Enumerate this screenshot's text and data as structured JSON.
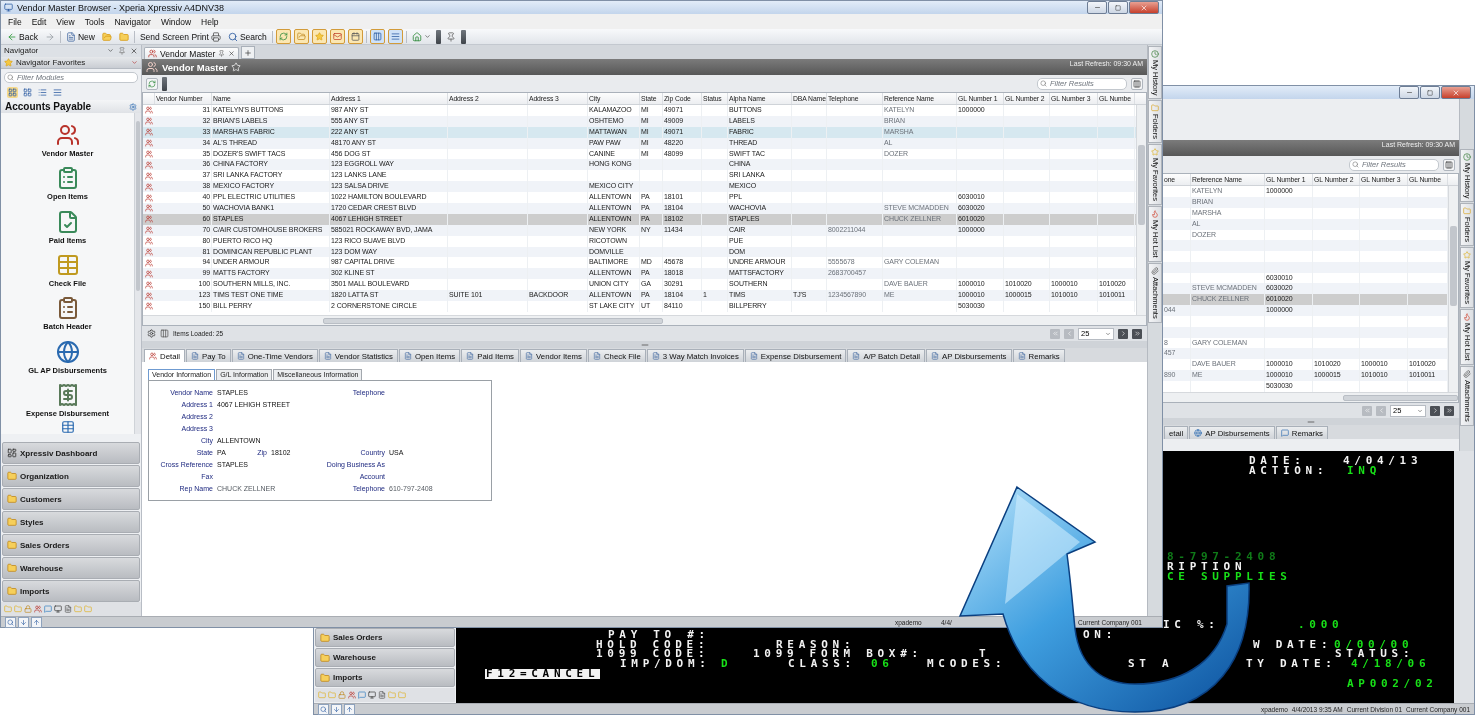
{
  "main_window": {
    "title": "Vendor Master Browser - Xperia Xpressiv A4DNV38",
    "menu": [
      "File",
      "Edit",
      "View",
      "Tools",
      "Navigator",
      "Window",
      "Help"
    ],
    "toolbar": [
      {
        "kind": "back",
        "label": "Back"
      },
      {
        "kind": "new",
        "label": "New"
      },
      {
        "kind": "print",
        "label": "Send Screen Print"
      },
      {
        "kind": "search",
        "label": "Search"
      }
    ],
    "navigator": {
      "title": "Navigator",
      "favorites": "Navigator Favorites",
      "filter_placeholder": "Filter Modules",
      "section": "Accounts Payable",
      "modules": [
        {
          "kind": "vendor",
          "label": "Vendor Master"
        },
        {
          "kind": "open",
          "label": "Open Items"
        },
        {
          "kind": "paid",
          "label": "Paid Items"
        },
        {
          "kind": "check",
          "label": "Check File"
        },
        {
          "kind": "batch",
          "label": "Batch Header"
        },
        {
          "kind": "disbursement",
          "label": "GL AP Disbursements"
        },
        {
          "kind": "expense",
          "label": "Expense Disbursement"
        }
      ],
      "groups": [
        {
          "kind": "dashboard",
          "label": "Xpressiv Dashboard"
        },
        {
          "kind": "folder",
          "label": "Organization"
        },
        {
          "kind": "folder",
          "label": "Customers"
        },
        {
          "kind": "folder",
          "label": "Styles"
        },
        {
          "kind": "folder",
          "label": "Sales Orders"
        },
        {
          "kind": "folder",
          "label": "Warehouse"
        },
        {
          "kind": "folder",
          "label": "Imports"
        }
      ]
    },
    "document_tab": "Vendor Master",
    "header": {
      "title": "Vendor Master",
      "last_refresh": "Last Refresh: 09:30 AM"
    },
    "filter_placeholder": "Filter Results",
    "table": {
      "columns": [
        "Vendor Number",
        "Name",
        "Address 1",
        "Address 2",
        "Address 3",
        "City",
        "State",
        "Zip Code",
        "Status",
        "Alpha Name",
        "DBA Name",
        "Telephone",
        "Reference Name",
        "GL Number 1",
        "GL Number 2",
        "GL Number 3",
        "GL Numbe"
      ],
      "rows": [
        {
          "selected": false,
          "highlighted": false,
          "cells": [
            "31",
            "KATELYN'S BUTTONS",
            "987 ANY ST",
            null,
            null,
            "KALAMAZOO",
            "MI",
            "49071",
            null,
            "BUTTONS",
            null,
            null,
            "KATELYN",
            "1000000",
            null,
            null,
            null
          ]
        },
        {
          "selected": false,
          "highlighted": false,
          "cells": [
            "32",
            "BRIAN'S LABELS",
            "555 ANY ST",
            null,
            null,
            "OSHTEMO",
            "MI",
            "49009",
            null,
            "LABELS",
            null,
            null,
            "BRIAN",
            null,
            null,
            null,
            null
          ]
        },
        {
          "selected": false,
          "highlighted": true,
          "cells": [
            "33",
            "MARSHA'S FABRIC",
            "222 ANY ST",
            null,
            null,
            "MATTAWAN",
            "MI",
            "49071",
            null,
            "FABRIC",
            null,
            null,
            "MARSHA",
            null,
            null,
            null,
            null
          ]
        },
        {
          "selected": false,
          "highlighted": false,
          "cells": [
            "34",
            "AL'S THREAD",
            "48170 ANY ST",
            null,
            null,
            "PAW PAW",
            "MI",
            "48220",
            null,
            "THREAD",
            null,
            null,
            "AL",
            null,
            null,
            null,
            null
          ]
        },
        {
          "selected": false,
          "highlighted": false,
          "cells": [
            "35",
            "DOZER'S SWIFT TACS",
            "456 DOG ST",
            null,
            null,
            "CANINE",
            "MI",
            "48099",
            null,
            "SWIFT TAC",
            null,
            null,
            "DOZER",
            null,
            null,
            null,
            null
          ]
        },
        {
          "selected": false,
          "highlighted": false,
          "cells": [
            "36",
            "CHINA FACTORY",
            "123 EGGROLL WAY",
            null,
            null,
            "HONG KONG",
            null,
            null,
            null,
            "CHINA",
            null,
            null,
            null,
            null,
            null,
            null,
            null
          ]
        },
        {
          "selected": false,
          "highlighted": false,
          "cells": [
            "37",
            "SRI LANKA FACTORY",
            "123 LANKS LANE",
            null,
            null,
            null,
            null,
            null,
            null,
            "SRI LANKA",
            null,
            null,
            null,
            null,
            null,
            null,
            null
          ]
        },
        {
          "selected": false,
          "highlighted": false,
          "cells": [
            "38",
            "MEXICO FACTORY",
            "123 SALSA DRIVE",
            null,
            null,
            "MEXICO CITY",
            null,
            null,
            null,
            "MEXICO",
            null,
            null,
            null,
            null,
            null,
            null,
            null
          ]
        },
        {
          "selected": false,
          "highlighted": false,
          "cells": [
            "40",
            "PPL ELECTRIC UTILITIES",
            "1022 HAMILTON BOULEVARD",
            null,
            null,
            "ALLENTOWN",
            "PA",
            "18101",
            null,
            "PPL",
            null,
            null,
            null,
            "6030010",
            null,
            null,
            null
          ]
        },
        {
          "selected": false,
          "highlighted": false,
          "cells": [
            "50",
            "WACHOVIA BANK1",
            "1720 CEDAR CREST BLVD",
            null,
            null,
            "ALLENTOWN",
            "PA",
            "18104",
            null,
            "WACHOVIA",
            null,
            null,
            "STEVE MCMADDEN",
            "6030020",
            null,
            null,
            null
          ]
        },
        {
          "selected": true,
          "highlighted": false,
          "cells": [
            "60",
            "STAPLES",
            "4067 LEHIGH STREET",
            null,
            null,
            "ALLENTOWN",
            "PA",
            "18102",
            null,
            "STAPLES",
            null,
            null,
            "CHUCK ZELLNER",
            "6010020",
            null,
            null,
            null
          ]
        },
        {
          "selected": false,
          "highlighted": false,
          "cells": [
            "70",
            "C/AIR CUSTOMHOUSE BROKERS",
            "585021 ROCKAWAY BVD, JAMA",
            null,
            null,
            "NEW YORK",
            "NY",
            "11434",
            null,
            "CAIR",
            null,
            "8002211044",
            null,
            "1000000",
            null,
            null,
            null
          ]
        },
        {
          "selected": false,
          "highlighted": false,
          "cells": [
            "80",
            "PUERTO RICO HQ",
            "123 RICO SUAVE BLVD",
            null,
            null,
            "RICOTOWN",
            null,
            null,
            null,
            "PUE",
            null,
            null,
            null,
            null,
            null,
            null,
            null
          ]
        },
        {
          "selected": false,
          "highlighted": false,
          "cells": [
            "81",
            "DOMINICAN REPUBLIC PLANT",
            "123 DOM WAY",
            null,
            null,
            "DOMVILLE",
            null,
            null,
            null,
            "DOM",
            null,
            null,
            null,
            null,
            null,
            null,
            null
          ]
        },
        {
          "selected": false,
          "highlighted": false,
          "cells": [
            "94",
            "UNDER ARMOUR",
            "987 CAPITAL DRIVE",
            null,
            null,
            "BALTIMORE",
            "MD",
            "45678",
            null,
            "UNDRE ARMOUR",
            null,
            "5555678",
            "GARY COLEMAN",
            null,
            null,
            null,
            null
          ]
        },
        {
          "selected": false,
          "highlighted": false,
          "cells": [
            "99",
            "MATTS FACTORY",
            "302 KLINE ST",
            null,
            null,
            "ALLENTOWN",
            "PA",
            "18018",
            null,
            "MATTSFACTORY",
            null,
            "2683700457",
            null,
            null,
            null,
            null,
            null
          ]
        },
        {
          "selected": false,
          "highlighted": false,
          "cells": [
            "100",
            "SOUTHERN MILLS, INC.",
            "3501 MALL BOULEVARD",
            null,
            null,
            "UNION CITY",
            "GA",
            "30291",
            null,
            "SOUTHERN",
            null,
            null,
            "DAVE BAUER",
            "1000010",
            "1010020",
            "1000010",
            "1010020"
          ]
        },
        {
          "selected": false,
          "highlighted": false,
          "cells": [
            "123",
            "TIMS TEST ONE TIME",
            "1820 LATTA ST",
            "SUITE 101",
            "BACKDOOR",
            "ALLENTOWN",
            "PA",
            "18104",
            "1",
            "TIMS",
            "TJ'S",
            "1234567890",
            "ME",
            "1000010",
            "1000015",
            "1010010",
            "1010011"
          ]
        },
        {
          "selected": false,
          "highlighted": false,
          "cells": [
            "150",
            "BILL PERRY",
            "2 CORNERSTONE CIRCLE",
            null,
            null,
            "ST LAKE CITY",
            "UT",
            "84110",
            null,
            "BILLPERRY",
            null,
            null,
            null,
            "5030030",
            null,
            null,
            null
          ]
        }
      ]
    },
    "items_loaded": "Items Loaded:  25",
    "page_size": "25",
    "detail_tabs": [
      {
        "label": "Detail",
        "selected": true
      },
      {
        "label": "Pay To",
        "selected": false
      },
      {
        "label": "One-Time Vendors",
        "selected": false
      },
      {
        "label": "Vendor Statistics",
        "selected": false
      },
      {
        "label": "Open Items",
        "selected": false
      },
      {
        "label": "Paid Items",
        "selected": false
      },
      {
        "label": "Vendor Items",
        "selected": false
      },
      {
        "label": "Check File",
        "selected": false
      },
      {
        "label": "3 Way Match Invoices",
        "selected": false
      },
      {
        "label": "Expense Disbursement",
        "selected": false
      },
      {
        "label": "A/P Batch Detail",
        "selected": false
      },
      {
        "label": "AP Disbursements",
        "selected": false
      },
      {
        "label": "Remarks",
        "selected": false
      }
    ],
    "form_tabs": [
      {
        "label": "Vendor Information",
        "selected": true
      },
      {
        "label": "G/L Information",
        "selected": false
      },
      {
        "label": "Miscellaneous Information",
        "selected": false
      }
    ],
    "form": [
      {
        "left": {
          "label": "Vendor Name",
          "value": "STAPLES"
        },
        "right": {
          "label": "Telephone"
        }
      },
      {
        "left": {
          "label": "Address 1",
          "value": "4067 LEHIGH STREET"
        }
      },
      {
        "left": {
          "label": "Address 2"
        }
      },
      {
        "left": {
          "label": "Address 3"
        }
      },
      {
        "left": {
          "label": "City",
          "value": "ALLENTOWN"
        }
      },
      {
        "left": {
          "label": "State",
          "value": "PA"
        },
        "middle": {
          "label": "Zip",
          "value": "18102"
        },
        "right": {
          "label": "Country",
          "value": "USA"
        }
      },
      {
        "left": {
          "label": "Cross Reference",
          "value": "STAPLES"
        },
        "right": {
          "label": "Doing Business As"
        }
      },
      {
        "left": {
          "label": "Fax"
        },
        "right": {
          "label": "Account"
        }
      },
      {
        "left": {
          "label": "Rep Name",
          "value": "CHUCK ZELLNER"
        },
        "right": {
          "label": "Telephone",
          "value": "610-797-2408"
        }
      }
    ],
    "side_tabs": [
      "My History",
      "Folders",
      "My Favorites",
      "My Hot List",
      "Attachments"
    ],
    "status_bar": [
      "xpademo",
      "4/4/",
      "Current Company 001"
    ]
  },
  "back_window": {
    "header": {
      "last_refresh": "Last Refresh: 09:30 AM"
    },
    "filter_placeholder": "Filter Results",
    "table": {
      "columns": [
        "one",
        "Reference Name",
        "GL Number 1",
        "GL Number 2",
        "GL Number 3",
        "GL Numbe"
      ],
      "rows": [
        {
          "selected": false,
          "cells": [
            null,
            "KATELYN",
            "1000000",
            null,
            null,
            null
          ]
        },
        {
          "selected": false,
          "cells": [
            null,
            "BRIAN",
            null,
            null,
            null,
            null
          ]
        },
        {
          "selected": false,
          "cells": [
            null,
            "MARSHA",
            null,
            null,
            null,
            null
          ]
        },
        {
          "selected": false,
          "cells": [
            null,
            "AL",
            null,
            null,
            null,
            null
          ]
        },
        {
          "selected": false,
          "cells": [
            null,
            "DOZER",
            null,
            null,
            null,
            null
          ]
        },
        {
          "selected": false,
          "cells": [
            null,
            null,
            null,
            null,
            null,
            null
          ]
        },
        {
          "selected": false,
          "cells": [
            null,
            null,
            null,
            null,
            null,
            null
          ]
        },
        {
          "selected": false,
          "cells": [
            null,
            null,
            null,
            null,
            null,
            null
          ]
        },
        {
          "selected": false,
          "cells": [
            null,
            null,
            "6030010",
            null,
            null,
            null
          ]
        },
        {
          "selected": false,
          "cells": [
            null,
            "STEVE MCMADDEN",
            "6030020",
            null,
            null,
            null
          ]
        },
        {
          "selected": true,
          "cells": [
            null,
            "CHUCK ZELLNER",
            "6010020",
            null,
            null,
            null
          ]
        },
        {
          "selected": false,
          "cells": [
            "044",
            null,
            "1000000",
            null,
            null,
            null
          ]
        },
        {
          "selected": false,
          "cells": [
            null,
            null,
            null,
            null,
            null,
            null
          ]
        },
        {
          "selected": false,
          "cells": [
            null,
            null,
            null,
            null,
            null,
            null
          ]
        },
        {
          "selected": false,
          "cells": [
            "8",
            "GARY COLEMAN",
            null,
            null,
            null,
            null
          ]
        },
        {
          "selected": false,
          "cells": [
            "457",
            null,
            null,
            null,
            null,
            null
          ]
        },
        {
          "selected": false,
          "cells": [
            null,
            "DAVE BAUER",
            "1000010",
            "1010020",
            "1000010",
            "1010020"
          ]
        },
        {
          "selected": false,
          "cells": [
            "890",
            "ME",
            "1000010",
            "1000015",
            "1010010",
            "1010011"
          ]
        },
        {
          "selected": false,
          "cells": [
            null,
            null,
            "5030030",
            null,
            null,
            null
          ]
        }
      ]
    },
    "page_size": "25",
    "detail_tabs": [
      {
        "label": "etail",
        "selected": false
      },
      {
        "label": "AP Disbursements",
        "selected": false
      },
      {
        "label": "Remarks",
        "selected": false
      }
    ],
    "side_tabs": [
      "My History",
      "Folders",
      "My Favorites",
      "My Hot List",
      "Attachments"
    ],
    "navigator_groups": [
      "Sales Orders",
      "Warehouse",
      "Imports"
    ],
    "terminal": [
      {
        "kind": "label",
        "text": "DATE:"
      },
      {
        "kind": "label",
        "text": "4/04/13"
      },
      {
        "kind": "label",
        "text": "ACTION:"
      },
      {
        "kind": "value",
        "text": "INQ"
      },
      {
        "kind": "faded",
        "text": "8-797-2408"
      },
      {
        "kind": "label",
        "text": "RIPTION"
      },
      {
        "kind": "value",
        "text": "CE SUPPLIES"
      },
      {
        "kind": "label",
        "text": "IC %:"
      },
      {
        "kind": "value",
        "text": ".000"
      },
      {
        "kind": "label",
        "text": "PAY TO #:"
      },
      {
        "kind": "label",
        "text": "ON:"
      },
      {
        "kind": "label",
        "text": "HOLD CODE:"
      },
      {
        "kind": "label",
        "text": "REASON:"
      },
      {
        "kind": "label",
        "text": "W DATE:"
      },
      {
        "kind": "value",
        "text": "0/00/00"
      },
      {
        "kind": "label",
        "text": "1099 CODE:"
      },
      {
        "kind": "label",
        "text": "1099 FORM BOX#:"
      },
      {
        "kind": "label",
        "text": "T"
      },
      {
        "kind": "label",
        "text": "STATUS:"
      },
      {
        "kind": "label",
        "text": "IMP/DOM:"
      },
      {
        "kind": "value",
        "text": "D"
      },
      {
        "kind": "label",
        "text": "CLASS:"
      },
      {
        "kind": "value",
        "text": "06"
      },
      {
        "kind": "label",
        "text": "MCODES:"
      },
      {
        "kind": "label",
        "text": "ST A"
      },
      {
        "kind": "label",
        "text": "TY DATE:"
      },
      {
        "kind": "value",
        "text": "4/18/06"
      },
      {
        "kind": "key",
        "text": "F12=CANCEL"
      },
      {
        "kind": "value",
        "text": "AP002/02"
      }
    ],
    "status_bar": [
      "xpademo",
      "4/4/2013  9:35 AM",
      "Current Division 01",
      "Current Company 001"
    ]
  }
}
